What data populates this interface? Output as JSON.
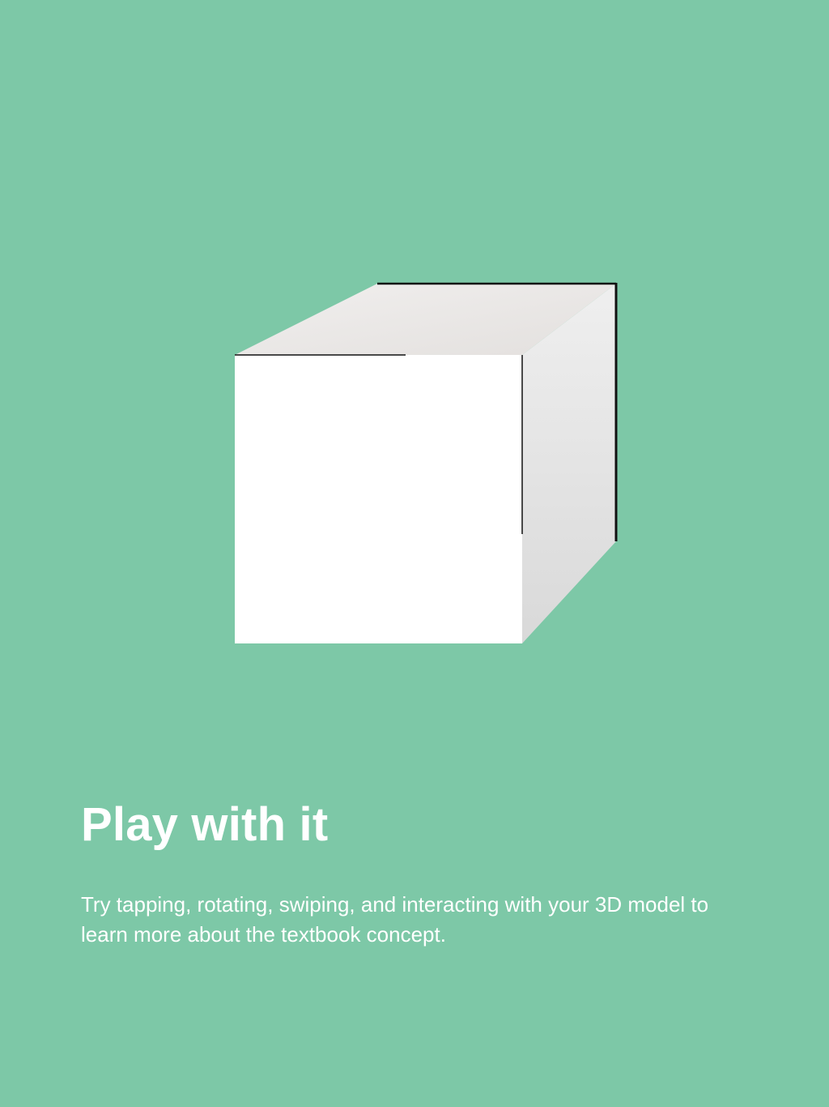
{
  "model_viewer": {
    "model_icon": "cube-3d-model"
  },
  "onboarding": {
    "title": "Play with it",
    "description": "Try tapping, rotating, swiping, and interacting with your 3D model to learn more about the textbook concept."
  },
  "colors": {
    "background": "#7dc8a7",
    "text": "#ffffff",
    "cube_front": "#ffffff",
    "cube_top": "#ebe9e8",
    "cube_side": "#e2e2e2",
    "edge_line": "#111111"
  }
}
